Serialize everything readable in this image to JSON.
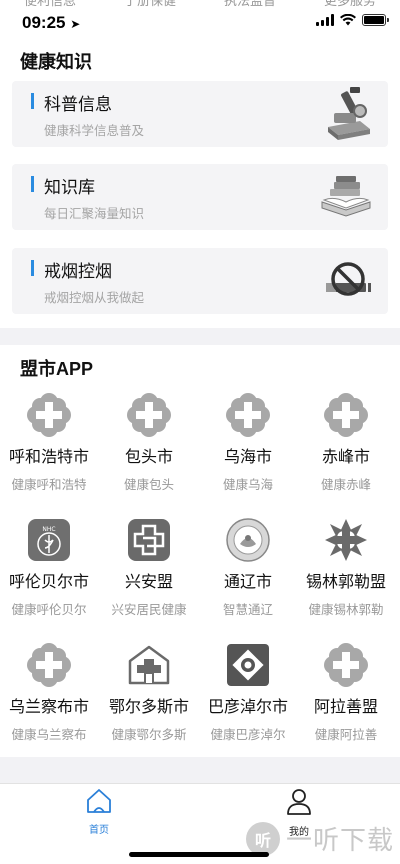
{
  "status": {
    "time": "09:25"
  },
  "top_tabs": [
    "便利信息",
    "于册保健",
    "执法监督",
    "更多服务"
  ],
  "health_knowledge": {
    "title": "健康知识",
    "cards": [
      {
        "title": "科普信息",
        "subtitle": "健康科学信息普及",
        "icon": "microscope-icon"
      },
      {
        "title": "知识库",
        "subtitle": "每日汇聚海量知识",
        "icon": "books-icon"
      },
      {
        "title": "戒烟控烟",
        "subtitle": "戒烟控烟从我做起",
        "icon": "no-smoking-icon"
      }
    ]
  },
  "league_apps": {
    "title": "盟市APP",
    "items": [
      {
        "name": "呼和浩特市",
        "sub": "健康呼和浩特",
        "icon": "medical-cross-icon"
      },
      {
        "name": "包头市",
        "sub": "健康包头",
        "icon": "medical-cross-icon"
      },
      {
        "name": "乌海市",
        "sub": "健康乌海",
        "icon": "medical-cross-icon"
      },
      {
        "name": "赤峰市",
        "sub": "健康赤峰",
        "icon": "medical-cross-icon"
      },
      {
        "name": "呼伦贝尔市",
        "sub": "健康呼伦贝尔",
        "icon": "nhc-emblem-icon"
      },
      {
        "name": "兴安盟",
        "sub": "兴安居民健康",
        "icon": "hospital-cross-icon"
      },
      {
        "name": "通辽市",
        "sub": "智慧通辽",
        "icon": "seal-emblem-icon"
      },
      {
        "name": "锡林郭勒盟",
        "sub": "健康锡林郭勒",
        "icon": "star-cross-icon"
      },
      {
        "name": "乌兰察布市",
        "sub": "健康乌兰察布",
        "icon": "medical-cross-icon"
      },
      {
        "name": "鄂尔多斯市",
        "sub": "健康鄂尔多斯",
        "icon": "yurt-cross-icon"
      },
      {
        "name": "巴彦淖尔市",
        "sub": "健康巴彦淖尔",
        "icon": "diamond-emblem-icon"
      },
      {
        "name": "阿拉善盟",
        "sub": "健康阿拉善",
        "icon": "medical-cross-icon"
      }
    ]
  },
  "tabbar": {
    "home": {
      "label": "首页",
      "icon": "home-icon",
      "color": "#2a7fd8"
    },
    "mine": {
      "label": "我的",
      "icon": "user-icon",
      "color": "#222222"
    }
  },
  "watermark": {
    "logo_text": "听",
    "text": "一听下载"
  }
}
